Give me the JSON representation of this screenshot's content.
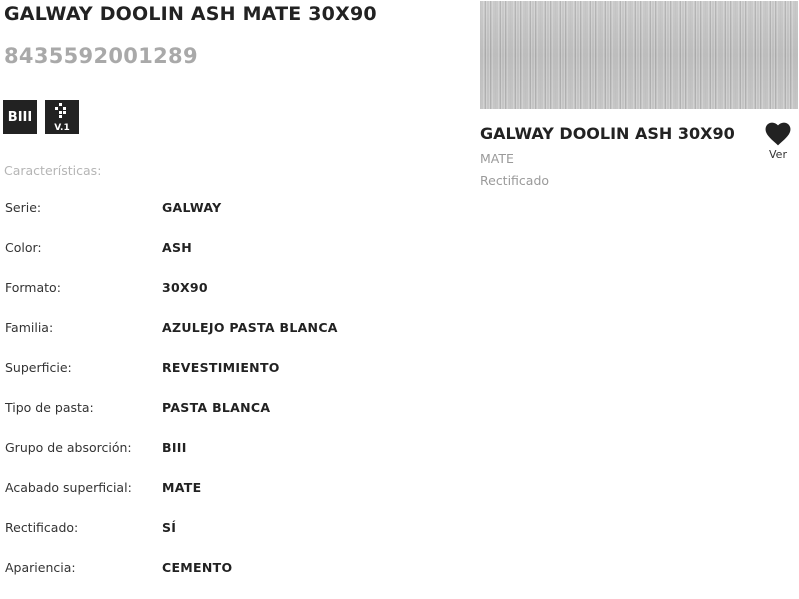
{
  "product": {
    "title": "GALWAY DOOLIN ASH MATE 30X90",
    "ean": "8435592001289",
    "badges": {
      "absorption": "BIII",
      "version": "V.1"
    },
    "features_heading": "Características:",
    "specs": [
      {
        "label": "Serie:",
        "value": "GALWAY"
      },
      {
        "label": "Color:",
        "value": "ASH"
      },
      {
        "label": "Formato:",
        "value": "30X90"
      },
      {
        "label": "Familia:",
        "value": "AZULEJO PASTA BLANCA"
      },
      {
        "label": "Superficie:",
        "value": "REVESTIMIENTO"
      },
      {
        "label": "Tipo de pasta:",
        "value": "PASTA BLANCA"
      },
      {
        "label": "Grupo de absorción:",
        "value": "BIII"
      },
      {
        "label": "Acabado superficial:",
        "value": "MATE"
      },
      {
        "label": "Rectificado:",
        "value": "SÍ"
      },
      {
        "label": "Apariencia:",
        "value": "CEMENTO"
      }
    ]
  },
  "card": {
    "title": "GALWAY DOOLIN ASH 30X90",
    "finish": "MATE",
    "rectified": "Rectificado",
    "favorite_label": "Ver",
    "favorite_icon": "heart-icon"
  },
  "colors": {
    "text_dark": "#222222",
    "text_muted": "#a9a9a9",
    "badge_bg": "#222222",
    "tile_gray": "#c4c4c4"
  }
}
